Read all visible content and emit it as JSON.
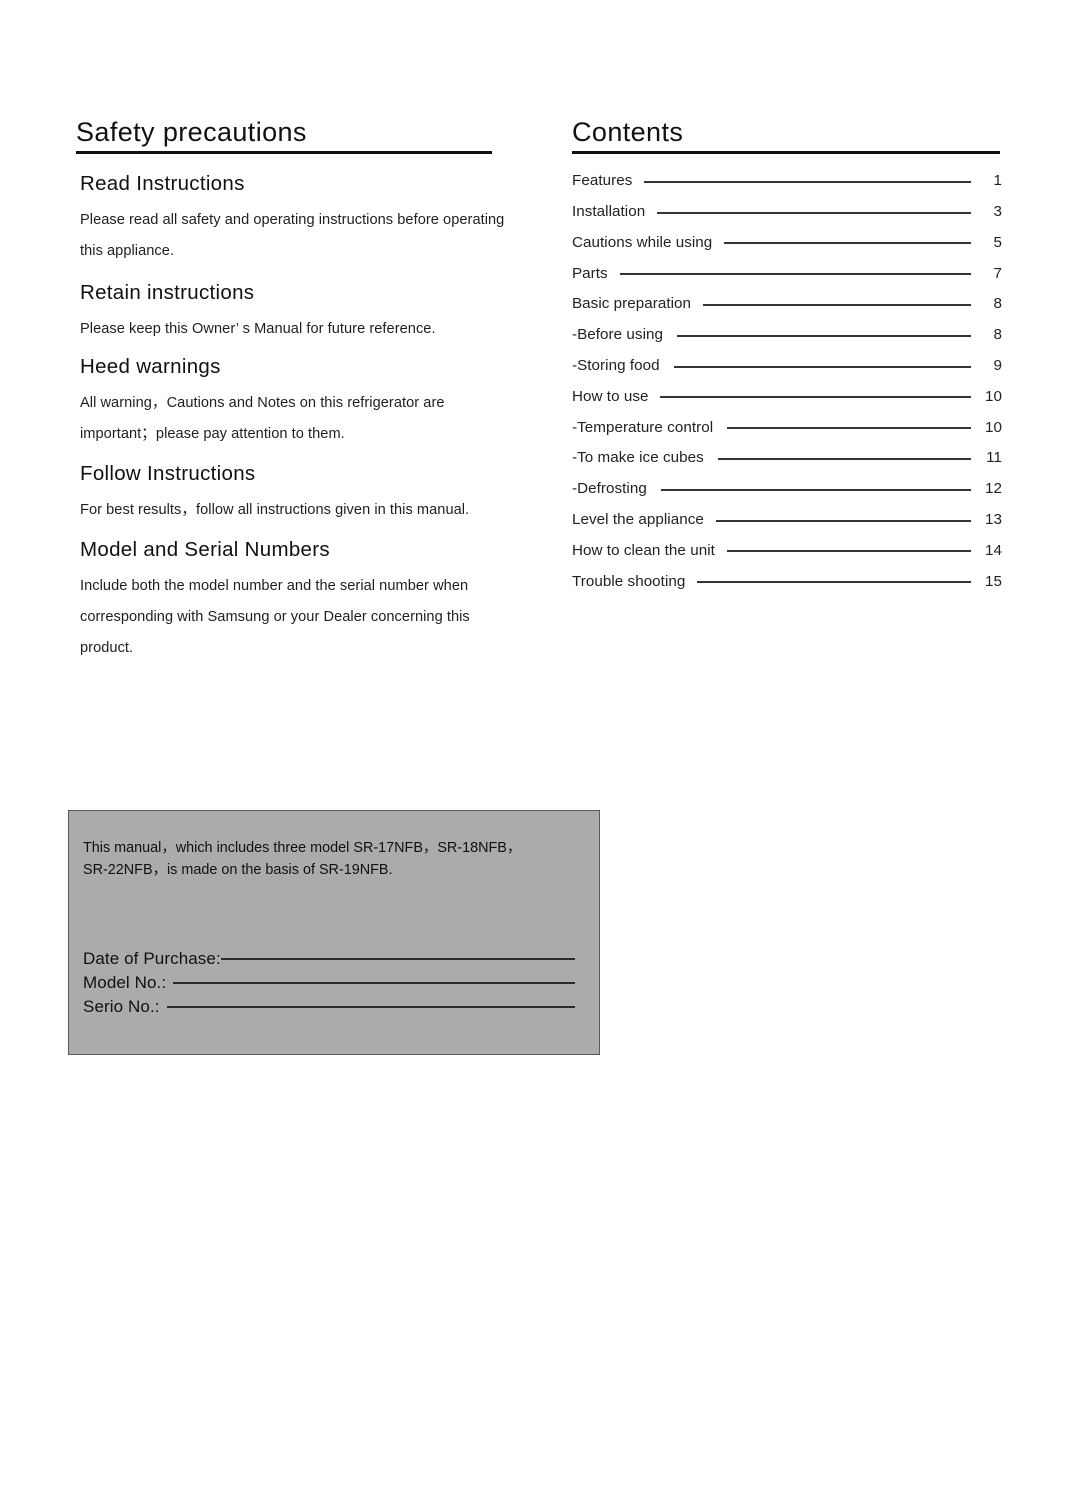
{
  "document": {
    "left_column": {
      "title": "Safety precautions",
      "sections": [
        {
          "heading": "Read Instructions",
          "lines": [
            "Please read all safety and operating instructions before operating",
            "this appliance."
          ]
        },
        {
          "heading": "Retain instructions",
          "lines": [
            "Please keep this Owner’  s Manual for future reference."
          ]
        },
        {
          "heading": "Heed warnings",
          "lines": [
            "All warning，Cautions and Notes on this refrigerator are",
            "important；please pay attention to them."
          ]
        },
        {
          "heading": "Follow Instructions",
          "lines": [
            "For best results，follow all instructions given in this manual."
          ]
        },
        {
          "heading": "Model and Serial Numbers",
          "lines": [
            "Include both the model number and the serial number when",
            "corresponding with Samsung or your Dealer concerning this",
            "product."
          ]
        }
      ]
    },
    "right_column": {
      "title": "Contents",
      "entries": [
        {
          "label": "Features",
          "page": "1",
          "sub": false
        },
        {
          "label": "Installation",
          "page": "3",
          "sub": false
        },
        {
          "label": "Cautions while using",
          "page": "5",
          "sub": false
        },
        {
          "label": "Parts",
          "page": "7",
          "sub": false
        },
        {
          "label": "Basic preparation",
          "page": "8",
          "sub": false
        },
        {
          "label": "-Before using",
          "page": "8",
          "sub": true
        },
        {
          "label": "-Storing food",
          "page": "9",
          "sub": true
        },
        {
          "label": "How to use",
          "page": "10",
          "sub": false
        },
        {
          "label": "-Temperature control",
          "page": "10",
          "sub": true
        },
        {
          "label": "-To make ice cubes",
          "page": "11",
          "sub": true
        },
        {
          "label": "-Defrosting",
          "page": "12",
          "sub": true
        },
        {
          "label": "Level the appliance",
          "page": "13",
          "sub": false
        },
        {
          "label": "How to clean the unit",
          "page": "14",
          "sub": false
        },
        {
          "label": "Trouble shooting",
          "page": "15",
          "sub": false
        }
      ]
    },
    "info_box": {
      "background_color": "#ababab",
      "note_lines": [
        "This manual，which includes three model SR-17NFB，SR-18NFB，",
        "SR-22NFB，is made on the basis of SR-19NFB."
      ],
      "fields": [
        {
          "label": "Date of Purchase:",
          "value": ""
        },
        {
          "label": "Model No.:",
          "value": ""
        },
        {
          "label": "Serio No.:",
          "value": ""
        }
      ]
    }
  }
}
